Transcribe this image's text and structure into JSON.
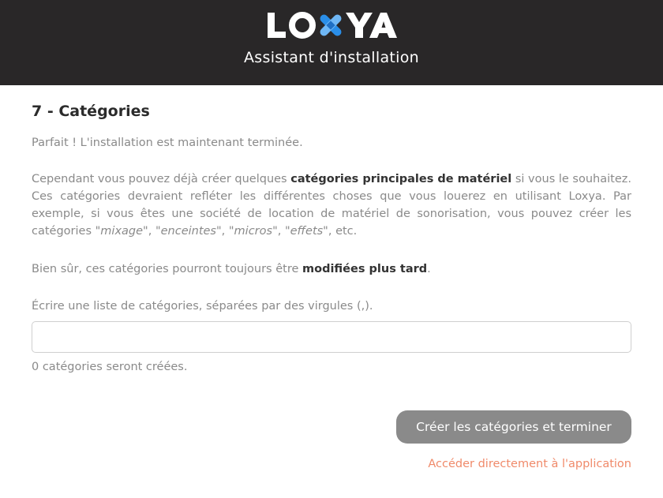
{
  "header": {
    "logo_text": "LOXYA",
    "subtitle": "Assistant d'installation"
  },
  "step": {
    "title": "7 - Catégories",
    "intro": "Parfait ! L'installation est maintenant terminée.",
    "para2_a": "Cependant vous pouvez déjà créer quelques ",
    "para2_bold": "catégories principales de matériel",
    "para2_b": " si vous le souhaitez.",
    "para2_c": "Ces catégories devraient refléter les différentes choses que vous louerez en utilisant Loxya. Par exemple, si vous êtes une société de location de matériel de sonorisation, vous pouvez créer les catégories ",
    "ex1": "\"mixage\"",
    "sep1": ", ",
    "ex2": "\"enceintes\"",
    "sep2": ", ",
    "ex3": "\"micros\"",
    "sep3": ", ",
    "ex4": "\"effets\"",
    "para2_end": ", etc.",
    "para3_a": "Bien sûr, ces catégories pourront toujours être ",
    "para3_bold": "modifiées plus tard",
    "para3_end": ".",
    "input_label": "Écrire une liste de catégories, séparées par des virgules (,).",
    "input_value": "",
    "count_text": "0 catégories seront créées.",
    "submit_label": "Créer les catégories et terminer",
    "skip_link": "Accéder directement à l'application"
  },
  "colors": {
    "header_bg": "#292728",
    "logo_accent": "#2a8ee8",
    "button_bg": "#8a8a8a",
    "link": "#f08a6a"
  }
}
